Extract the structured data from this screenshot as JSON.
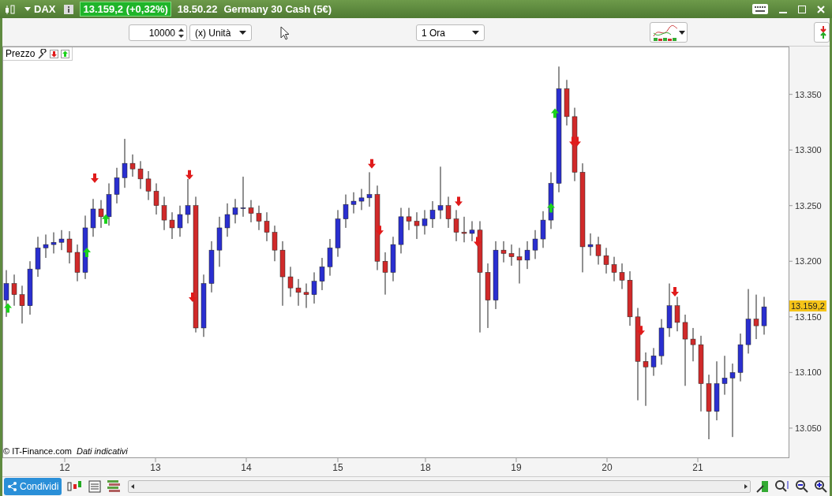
{
  "title_bar": {
    "symbol": "DAX",
    "price": "13.159,2 (+0,32%)",
    "time": "18.50.22",
    "instrument": "Germany 30 Cash (5€)"
  },
  "toolbar": {
    "quantity": "10000",
    "unit": "(x) Unità",
    "timeframe": "1 Ora"
  },
  "chart": {
    "panel_label": "Prezzo",
    "date_labels": [
      "12",
      "13",
      "14",
      "15",
      "18",
      "19",
      "20",
      "21"
    ],
    "price_tag": "13.159,2",
    "copyright": "© IT-Finance.com",
    "note": "Dati indicativi",
    "chart_data": {
      "type": "candlestick",
      "ylim": [
        13023,
        13393
      ],
      "yticks": [
        {
          "value": 13350,
          "label": "13.350"
        },
        {
          "value": 13300,
          "label": "13.300"
        },
        {
          "value": 13250,
          "label": "13.250"
        },
        {
          "value": 13200,
          "label": "13.200"
        },
        {
          "value": 13150,
          "label": "13.150"
        },
        {
          "value": 13100,
          "label": "13.100"
        },
        {
          "value": 13050,
          "label": "13.050"
        }
      ],
      "ohlc": [
        [
          13165,
          13192,
          13150,
          13180
        ],
        [
          13180,
          13188,
          13160,
          13170
        ],
        [
          13170,
          13178,
          13144,
          13160
        ],
        [
          13160,
          13200,
          13152,
          13193
        ],
        [
          13193,
          13222,
          13186,
          13212
        ],
        [
          13212,
          13224,
          13203,
          13215
        ],
        [
          13215,
          13226,
          13207,
          13217
        ],
        [
          13217,
          13228,
          13210,
          13220
        ],
        [
          13220,
          13227,
          13198,
          13208
        ],
        [
          13208,
          13215,
          13182,
          13190
        ],
        [
          13190,
          13241,
          13184,
          13230
        ],
        [
          13230,
          13256,
          13222,
          13247
        ],
        [
          13247,
          13255,
          13230,
          13240
        ],
        [
          13240,
          13270,
          13232,
          13260
        ],
        [
          13260,
          13284,
          13252,
          13275
        ],
        [
          13275,
          13310,
          13266,
          13288
        ],
        [
          13288,
          13296,
          13276,
          13283
        ],
        [
          13283,
          13290,
          13265,
          13274
        ],
        [
          13274,
          13281,
          13255,
          13263
        ],
        [
          13263,
          13270,
          13242,
          13250
        ],
        [
          13250,
          13258,
          13228,
          13237
        ],
        [
          13237,
          13244,
          13220,
          13230
        ],
        [
          13230,
          13250,
          13222,
          13242
        ],
        [
          13242,
          13274,
          13234,
          13250
        ],
        [
          13250,
          13258,
          13136,
          13140
        ],
        [
          13140,
          13188,
          13132,
          13180
        ],
        [
          13180,
          13218,
          13172,
          13210
        ],
        [
          13210,
          13240,
          13195,
          13230
        ],
        [
          13230,
          13252,
          13222,
          13242
        ],
        [
          13242,
          13256,
          13234,
          13248
        ],
        [
          13248,
          13276,
          13240,
          13248
        ],
        [
          13248,
          13255,
          13235,
          13243
        ],
        [
          13243,
          13250,
          13228,
          13236
        ],
        [
          13236,
          13244,
          13218,
          13226
        ],
        [
          13226,
          13232,
          13200,
          13210
        ],
        [
          13210,
          13218,
          13160,
          13186
        ],
        [
          13186,
          13195,
          13168,
          13176
        ],
        [
          13176,
          13184,
          13160,
          13172
        ],
        [
          13172,
          13180,
          13158,
          13170
        ],
        [
          13170,
          13190,
          13162,
          13182
        ],
        [
          13182,
          13203,
          13174,
          13195
        ],
        [
          13195,
          13220,
          13187,
          13212
        ],
        [
          13212,
          13246,
          13204,
          13238
        ],
        [
          13238,
          13260,
          13230,
          13251
        ],
        [
          13251,
          13262,
          13243,
          13254
        ],
        [
          13254,
          13265,
          13246,
          13257
        ],
        [
          13257,
          13280,
          13249,
          13260
        ],
        [
          13260,
          13268,
          13192,
          13200
        ],
        [
          13200,
          13208,
          13170,
          13190
        ],
        [
          13190,
          13222,
          13182,
          13215
        ],
        [
          13215,
          13248,
          13207,
          13240
        ],
        [
          13240,
          13248,
          13228,
          13236
        ],
        [
          13236,
          13244,
          13220,
          13232
        ],
        [
          13232,
          13246,
          13224,
          13238
        ],
        [
          13238,
          13254,
          13230,
          13246
        ],
        [
          13246,
          13285,
          13238,
          13250
        ],
        [
          13250,
          13258,
          13230,
          13238
        ],
        [
          13238,
          13246,
          13218,
          13226
        ],
        [
          13226,
          13240,
          13217,
          13225
        ],
        [
          13225,
          13236,
          13218,
          13228
        ],
        [
          13228,
          13236,
          13136,
          13190
        ],
        [
          13190,
          13198,
          13140,
          13165
        ],
        [
          13165,
          13218,
          13157,
          13210
        ],
        [
          13210,
          13218,
          13199,
          13207
        ],
        [
          13207,
          13215,
          13196,
          13204
        ],
        [
          13204,
          13212,
          13180,
          13201
        ],
        [
          13201,
          13218,
          13193,
          13210
        ],
        [
          13210,
          13228,
          13202,
          13220
        ],
        [
          13220,
          13245,
          13212,
          13237
        ],
        [
          13237,
          13280,
          13229,
          13270
        ],
        [
          13270,
          13375,
          13262,
          13355
        ],
        [
          13355,
          13363,
          13322,
          13330
        ],
        [
          13330,
          13338,
          13272,
          13280
        ],
        [
          13280,
          13288,
          13190,
          13213
        ],
        [
          13213,
          13225,
          13205,
          13215
        ],
        [
          13215,
          13222,
          13197,
          13205
        ],
        [
          13205,
          13212,
          13189,
          13197
        ],
        [
          13197,
          13204,
          13182,
          13190
        ],
        [
          13190,
          13198,
          13175,
          13183
        ],
        [
          13183,
          13191,
          13142,
          13150
        ],
        [
          13150,
          13158,
          13075,
          13110
        ],
        [
          13110,
          13118,
          13070,
          13105
        ],
        [
          13105,
          13122,
          13097,
          13115
        ],
        [
          13115,
          13148,
          13107,
          13140
        ],
        [
          13140,
          13180,
          13132,
          13160
        ],
        [
          13160,
          13168,
          13137,
          13145
        ],
        [
          13145,
          13152,
          13088,
          13130
        ],
        [
          13130,
          13140,
          13110,
          13125
        ],
        [
          13125,
          13133,
          13065,
          13090
        ],
        [
          13090,
          13098,
          13040,
          13065
        ],
        [
          13065,
          13110,
          13057,
          13090
        ],
        [
          13090,
          13115,
          13080,
          13095
        ],
        [
          13095,
          13108,
          13042,
          13100
        ],
        [
          13100,
          13135,
          13092,
          13125
        ],
        [
          13125,
          13175,
          13117,
          13148
        ],
        [
          13148,
          13170,
          13130,
          13142
        ],
        [
          13142,
          13168,
          13134,
          13159
        ]
      ]
    }
  },
  "bottom_bar": {
    "share": "Condividi"
  }
}
